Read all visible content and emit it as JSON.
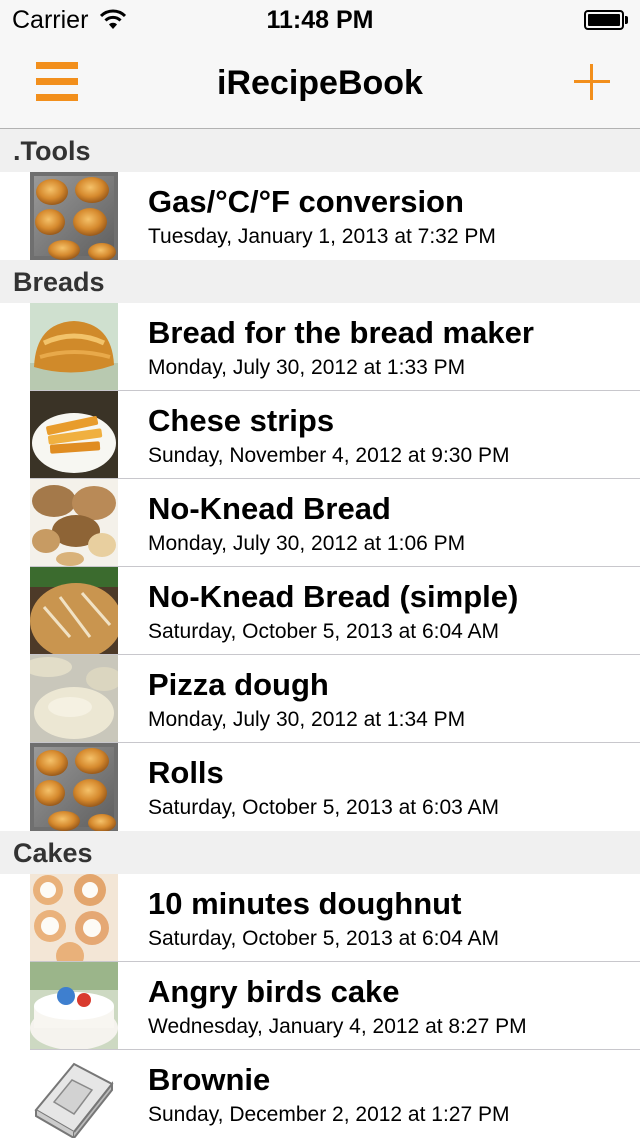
{
  "status_bar": {
    "carrier": "Carrier",
    "time": "11:48 PM"
  },
  "nav": {
    "title": "iRecipeBook",
    "accent_color": "#F28F1C",
    "left_icon": "menu-icon",
    "right_icon": "plus-icon"
  },
  "sections": [
    {
      "title": ".Tools",
      "items": [
        {
          "name": "Gas/°C/°F conversion",
          "date": "Tuesday, January 1, 2013 at 7:32 PM",
          "thumb": "rolls-thumbnail"
        }
      ]
    },
    {
      "title": "Breads",
      "items": [
        {
          "name": "Bread for the bread maker",
          "date": "Monday, July 30, 2012 at 1:33 PM",
          "thumb": "loaf-thumbnail"
        },
        {
          "name": "Chese strips",
          "date": "Sunday, November 4, 2012 at 9:30 PM",
          "thumb": "cheese-strips-thumbnail"
        },
        {
          "name": "No-Knead Bread",
          "date": "Monday, July 30, 2012 at 1:06 PM",
          "thumb": "bread-pile-thumbnail"
        },
        {
          "name": "No-Knead Bread (simple)",
          "date": "Saturday, October 5, 2013 at 6:04 AM",
          "thumb": "rustic-loaf-thumbnail"
        },
        {
          "name": "Pizza dough",
          "date": "Monday, July 30, 2012 at 1:34 PM",
          "thumb": "dough-thumbnail"
        },
        {
          "name": "Rolls",
          "date": "Saturday, October 5, 2013 at 6:03 AM",
          "thumb": "rolls-thumbnail"
        }
      ]
    },
    {
      "title": "Cakes",
      "items": [
        {
          "name": "10 minutes doughnut",
          "date": "Saturday, October 5, 2013 at 6:04 AM",
          "thumb": "doughnuts-thumbnail"
        },
        {
          "name": "Angry birds cake",
          "date": "Wednesday, January 4, 2012 at 8:27 PM",
          "thumb": "cake-thumbnail"
        },
        {
          "name": "Brownie",
          "date": "Sunday, December 2, 2012 at 1:27 PM",
          "thumb": "book-icon"
        }
      ]
    }
  ]
}
